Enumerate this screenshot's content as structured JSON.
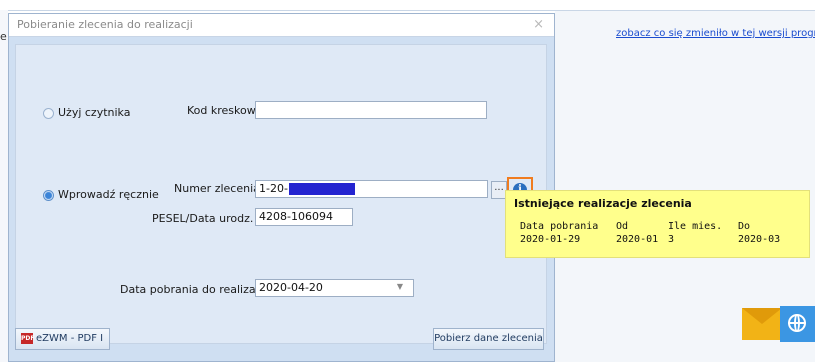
{
  "background": {
    "left_fragment": "e",
    "link_text": "zobacz co się zmieniło w tej wersji programu?"
  },
  "dialog": {
    "title": "Pobieranie zlecenia do realizacji",
    "close_glyph": "×",
    "use_reader": {
      "label": "Użyj czytnika",
      "selected": false
    },
    "barcode": {
      "label": "Kod kreskowy",
      "value": ""
    },
    "manual": {
      "label": "Wprowadź ręcznie",
      "selected": true
    },
    "order_number": {
      "label": "Numer zlecenia",
      "value": "1-20-"
    },
    "pesel": {
      "label": "PESEL/Data urodz.",
      "value": "4208-106094"
    },
    "fetch_date": {
      "label": "Data pobrania do realizacji",
      "value": "2020-04-20"
    },
    "ellipsis_label": "...",
    "info_glyph": "i",
    "pdf_badge": "PDF",
    "ezwm_button": "eZWM - PDF I",
    "fetch_button": "Pobierz dane zlecenia"
  },
  "tooltip": {
    "title": "Istniejące realizacje zlecenia",
    "headers": [
      "Data pobrania",
      "Od",
      "Ile mies.",
      "Do"
    ],
    "rows": [
      [
        "2020-01-29",
        "2020-01",
        "3",
        "2020-03"
      ]
    ]
  },
  "colors": {
    "dialog_bg": "#cfdff2",
    "panel_bg": "#dfe9f6",
    "highlight": "#f07c1f",
    "tooltip_bg": "#ffff8c",
    "redaction": "#2424d0",
    "link": "#1a4ccf"
  },
  "icons": [
    "close-icon",
    "info-icon",
    "pdf-icon",
    "dropdown-caret-icon",
    "mail-icon",
    "globe-icon"
  ]
}
